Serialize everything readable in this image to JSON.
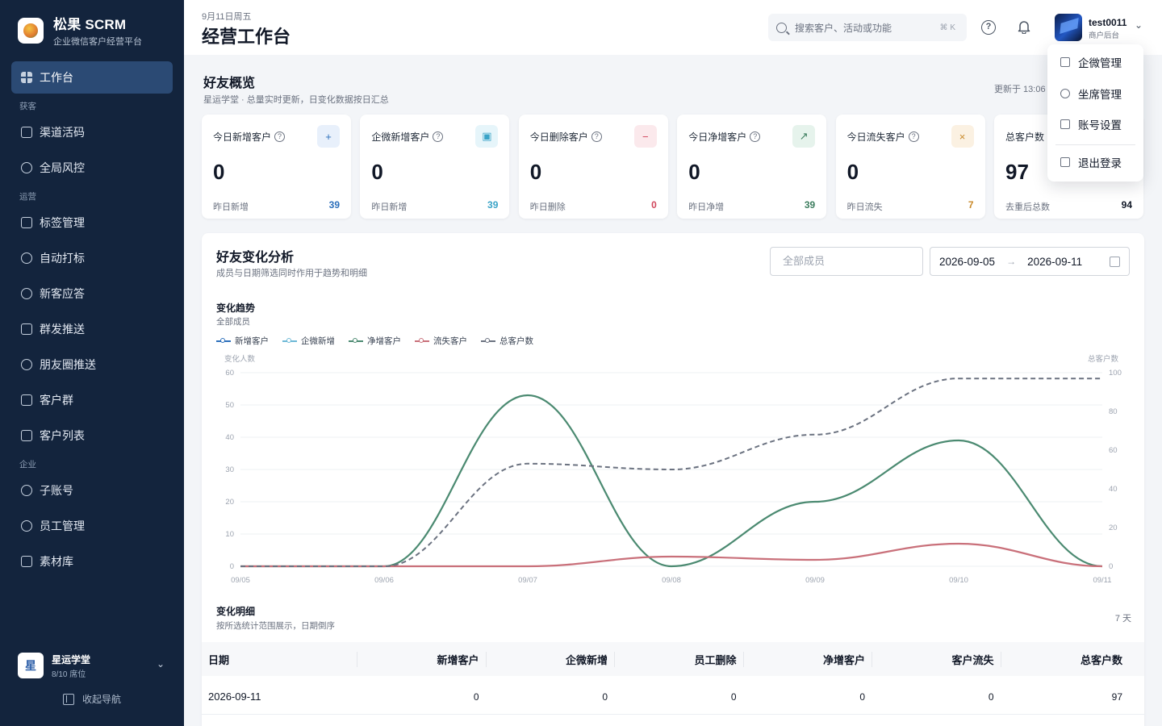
{
  "sidebar": {
    "brand_name": "松果 SCRM",
    "brand_sub": "企业微信客户经营平台",
    "workbench": "工作台",
    "group_acquire": "获客",
    "channel_code": "渠道活码",
    "risk_control": "全局风控",
    "group_operate": "运营",
    "tag_manage": "标签管理",
    "auto_tag": "自动打标",
    "new_reply": "新客应答",
    "group_push": "群发推送",
    "moments_push": "朋友圈推送",
    "customer_group": "客户群",
    "customer_list": "客户列表",
    "group_enterprise": "企业",
    "sub_account": "子账号",
    "staff_manage": "员工管理",
    "material_lib": "素材库",
    "org_badge": "星",
    "org_name": "星运学堂",
    "org_seat": "8/10 席位",
    "collapse": "收起导航"
  },
  "header": {
    "date": "9月11日周五",
    "title": "经营工作台",
    "search_placeholder": "搜索客户、活动或功能",
    "search_kbd": "⌘ K",
    "user_name": "test0011",
    "user_role": "商户后台"
  },
  "overview": {
    "title": "好友概览",
    "subtitle": "星运学堂 · 总量实时更新，日变化数据按日汇总",
    "updated": "更新于 13:06",
    "cards": [
      {
        "label": "今日新增客户",
        "value": "0",
        "foot": "昨日新增",
        "foot_value": "39",
        "accent": "#2c6fbb",
        "chip_bg": "#e8f0fb",
        "icon": "user-plus"
      },
      {
        "label": "企微新增客户",
        "value": "0",
        "foot": "昨日新增",
        "foot_value": "39",
        "accent": "#3aa3c7",
        "chip_bg": "#e6f5fa",
        "icon": "id-card"
      },
      {
        "label": "今日删除客户",
        "value": "0",
        "foot": "昨日删除",
        "foot_value": "0",
        "accent": "#d0455b",
        "chip_bg": "#fbe9ec",
        "icon": "user-minus"
      },
      {
        "label": "今日净增客户",
        "value": "0",
        "foot": "昨日净增",
        "foot_value": "39",
        "accent": "#3c7d5e",
        "chip_bg": "#e6f3ec",
        "icon": "trend-up"
      },
      {
        "label": "今日流失客户",
        "value": "0",
        "foot": "昨日流失",
        "foot_value": "7",
        "accent": "#c98a2b",
        "chip_bg": "#fbf1e2",
        "icon": "user-x"
      },
      {
        "label": "总客户数",
        "value": "97",
        "foot": "去重后总数",
        "foot_value": "94",
        "accent": "#111827",
        "chip_bg": "#f3f4f6",
        "icon": "users"
      }
    ]
  },
  "analysis": {
    "title": "好友变化分析",
    "subtitle": "成员与日期筛选同时作用于趋势和明细",
    "member_placeholder": "全部成员",
    "date_start": "2026-09-05",
    "date_end": "2026-09-11",
    "trend_title": "变化趋势",
    "trend_sub": "全部成员",
    "detail_title": "变化明细",
    "detail_sub": "按所选统计范围展示，日期倒序",
    "detail_days": "7 天"
  },
  "chart_data": {
    "type": "line",
    "x": [
      "09/05",
      "09/06",
      "09/07",
      "09/08",
      "09/09",
      "09/10",
      "09/11"
    ],
    "ylabel_left": "变化人数",
    "ylabel_right": "总客户数",
    "ylim_left": [
      0,
      60
    ],
    "ylim_right": [
      0,
      100
    ],
    "yticks_left": [
      0,
      10,
      20,
      30,
      40,
      50,
      60
    ],
    "yticks_right": [
      0,
      20,
      40,
      60,
      80,
      100
    ],
    "grid": true,
    "legend_position": "top-left",
    "series": [
      {
        "name": "新增客户",
        "axis": "left",
        "color": "#2c6fbb",
        "values": [
          0,
          0,
          53,
          0,
          20,
          39,
          0
        ],
        "visible": false
      },
      {
        "name": "企微新增",
        "axis": "left",
        "color": "#6cb8d6",
        "values": [
          0,
          0,
          53,
          0,
          20,
          39,
          0
        ],
        "visible": false
      },
      {
        "name": "净增客户",
        "axis": "left",
        "color": "#4b8a71",
        "values": [
          0,
          0,
          53,
          0,
          20,
          39,
          0
        ]
      },
      {
        "name": "流失客户",
        "axis": "left",
        "color": "#c9707a",
        "values": [
          0,
          0,
          0,
          3,
          2,
          7,
          0
        ]
      },
      {
        "name": "总客户数",
        "axis": "right",
        "color": "#6b7280",
        "dashed": true,
        "values": [
          0,
          0,
          53,
          50,
          68,
          97,
          97
        ]
      }
    ]
  },
  "table": {
    "headers": [
      "日期",
      "新增客户",
      "企微新增",
      "员工删除",
      "净增客户",
      "客户流失",
      "总客户数"
    ],
    "rows": [
      [
        "2026-09-11",
        "0",
        "0",
        "0",
        "0",
        "0",
        "97"
      ]
    ]
  },
  "user_menu": {
    "wecom_manage": "企微管理",
    "seat_manage": "坐席管理",
    "account_settings": "账号设置",
    "logout": "退出登录"
  }
}
